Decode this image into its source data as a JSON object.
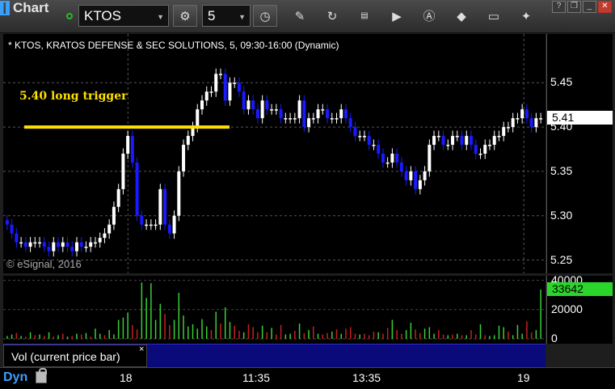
{
  "toolbar": {
    "title": "Chart",
    "symbol": "KTOS",
    "interval": "5",
    "icons": [
      "clock-icon",
      "pencil-icon",
      "cycle-icon",
      "study-icon",
      "play-icon",
      "alert-icon",
      "tools-icon",
      "comment-icon",
      "thumbtack-icon"
    ]
  },
  "chart": {
    "header": "* KTOS, KRATOS DEFENSE & SEC SOLUTIONS, 5, 09:30-16:00 (Dynamic)",
    "watermark": "© eSignal, 2016",
    "annotation": "5.40 long trigger",
    "current_price": "5.41",
    "current_volume": "33642",
    "volume_study_label": "Vol (current price bar)",
    "mode_label": "Dyn"
  },
  "colors": {
    "up_candle": "#ffffff",
    "down_candle": "#1a1aff",
    "trigger_line": "#ffe000",
    "volume_up": "#38d038",
    "volume_down": "#c62020"
  },
  "chart_data": [
    {
      "type": "candlestick",
      "title": "* KTOS, KRATOS DEFENSE & SEC SOLUTIONS, 5, 09:30-16:00 (Dynamic)",
      "xlabels": [
        "18",
        "11:35",
        "13:35",
        "19"
      ],
      "yticks": [
        5.25,
        5.3,
        5.35,
        5.4,
        5.45
      ],
      "ylim": [
        5.235,
        5.505
      ],
      "annotations": [
        {
          "text": "5.40 long trigger",
          "y": 5.4
        }
      ],
      "last_price": 5.41,
      "closes": [
        5.29,
        5.28,
        5.27,
        5.27,
        5.265,
        5.27,
        5.27,
        5.27,
        5.265,
        5.26,
        5.27,
        5.265,
        5.27,
        5.265,
        5.26,
        5.27,
        5.265,
        5.265,
        5.27,
        5.27,
        5.275,
        5.28,
        5.29,
        5.31,
        5.33,
        5.37,
        5.39,
        5.36,
        5.3,
        5.29,
        5.29,
        5.29,
        5.29,
        5.33,
        5.29,
        5.28,
        5.3,
        5.35,
        5.38,
        5.39,
        5.4,
        5.42,
        5.43,
        5.44,
        5.44,
        5.46,
        5.46,
        5.43,
        5.45,
        5.45,
        5.44,
        5.42,
        5.43,
        5.42,
        5.41,
        5.43,
        5.42,
        5.42,
        5.42,
        5.41,
        5.41,
        5.41,
        5.41,
        5.43,
        5.4,
        5.41,
        5.41,
        5.42,
        5.42,
        5.41,
        5.41,
        5.41,
        5.42,
        5.41,
        5.4,
        5.39,
        5.39,
        5.39,
        5.38,
        5.38,
        5.37,
        5.36,
        5.36,
        5.37,
        5.36,
        5.35,
        5.34,
        5.35,
        5.33,
        5.34,
        5.35,
        5.38,
        5.39,
        5.39,
        5.38,
        5.38,
        5.39,
        5.39,
        5.38,
        5.39,
        5.38,
        5.37,
        5.37,
        5.38,
        5.38,
        5.39,
        5.39,
        5.4,
        5.4,
        5.41,
        5.41,
        5.42,
        5.41,
        5.4,
        5.41,
        5.41
      ]
    },
    {
      "type": "bar",
      "title": "Vol (current price bar)",
      "yticks": [
        0,
        20000,
        40000
      ],
      "ylim": [
        0,
        42000
      ],
      "last_value": 33642,
      "values": [
        2000,
        3000,
        4000,
        2000,
        1500,
        4500,
        2500,
        3000,
        2000,
        4500,
        1500,
        2500,
        3500,
        1500,
        2000,
        3500,
        3000,
        4000,
        1500,
        7000,
        3500,
        2500,
        6000,
        3000,
        13000,
        14500,
        18000,
        9500,
        6500,
        38500,
        28000,
        38000,
        13000,
        24000,
        17000,
        9500,
        13000,
        31500,
        16000,
        8500,
        10000,
        7000,
        13500,
        8500,
        6000,
        18500,
        10500,
        21500,
        11500,
        9000,
        5500,
        4500,
        10000,
        8000,
        4500,
        9000,
        4500,
        7500,
        3000,
        9500,
        3000,
        3500,
        5500,
        10500,
        4000,
        6000,
        8500,
        3500,
        3000,
        4000,
        5000,
        6500,
        3500,
        7000,
        8000,
        3500,
        3000,
        3500,
        2500,
        5000,
        4500,
        3500,
        7500,
        13000,
        6000,
        3500,
        6000,
        11000,
        6500,
        4000,
        7000,
        8000,
        3500,
        6000,
        3000,
        2500,
        3000,
        3500,
        2500,
        2500,
        6000,
        3000,
        10000,
        2500,
        2000,
        2500,
        9000,
        8000,
        5000,
        2500,
        9500,
        3500,
        12000,
        4500,
        6000,
        33642
      ],
      "up": [
        1,
        1,
        0,
        1,
        0,
        1,
        0,
        1,
        0,
        1,
        0,
        1,
        0,
        1,
        0,
        1,
        0,
        1,
        0,
        1,
        1,
        0,
        1,
        1,
        1,
        1,
        1,
        0,
        0,
        1,
        1,
        1,
        1,
        1,
        0,
        0,
        1,
        1,
        1,
        1,
        1,
        1,
        1,
        1,
        0,
        1,
        0,
        1,
        1,
        0,
        0,
        1,
        0,
        0,
        0,
        1,
        0,
        1,
        0,
        0,
        1,
        1,
        0,
        1,
        0,
        1,
        0,
        1,
        0,
        0,
        1,
        0,
        1,
        0,
        0,
        0,
        1,
        0,
        0,
        0,
        1,
        0,
        0,
        1,
        0,
        0,
        1,
        1,
        0,
        0,
        1,
        1,
        1,
        0,
        0,
        1,
        0,
        1,
        0,
        1,
        0,
        0,
        1,
        0,
        1,
        1,
        1,
        1,
        0,
        1,
        1,
        1,
        0,
        0,
        1,
        1
      ]
    }
  ]
}
